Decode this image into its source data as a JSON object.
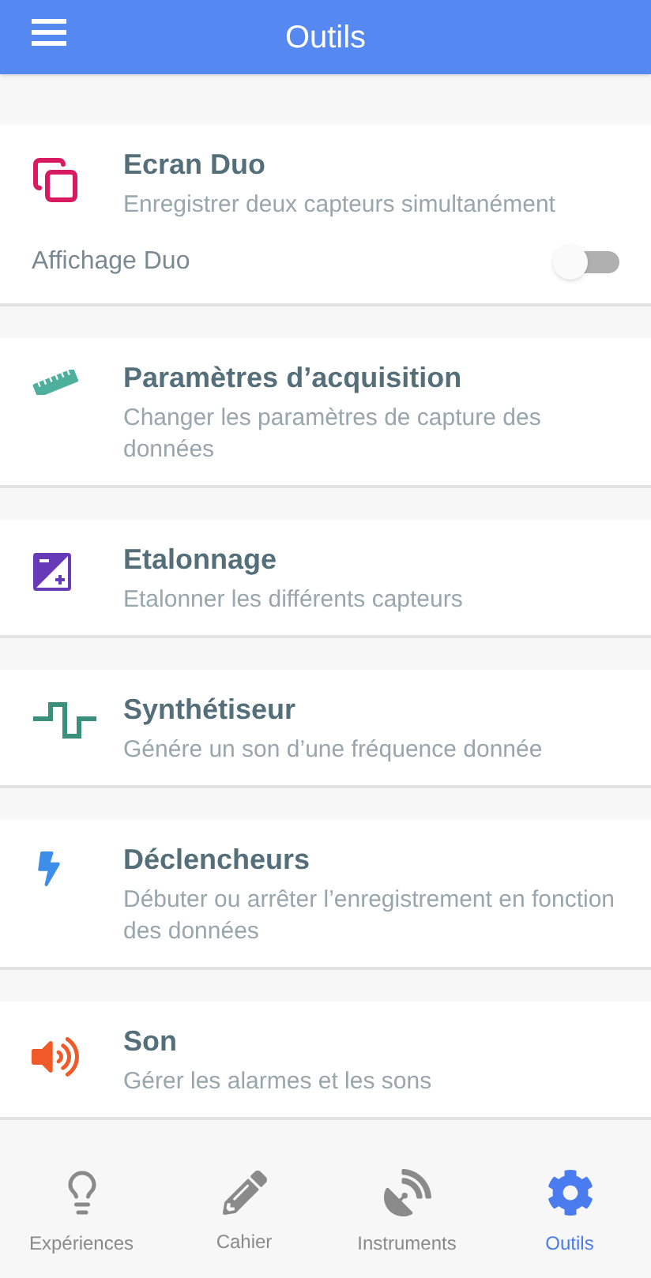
{
  "header": {
    "title": "Outils"
  },
  "tools": [
    {
      "title": "Ecran Duo",
      "subtitle": "Enregistrer deux capteurs simultanément",
      "toggle": {
        "label": "Affichage Duo",
        "on": false
      }
    },
    {
      "title": "Paramètres d’acquisition",
      "subtitle": "Changer les paramètres de capture des données"
    },
    {
      "title": "Etalonnage",
      "subtitle": "Etalonner les différents capteurs"
    },
    {
      "title": "Synthétiseur",
      "subtitle": "Génére un son d’une fréquence donnée"
    },
    {
      "title": "Déclencheurs",
      "subtitle": "Débuter ou arrêter l’enregistrement en fonction des données"
    },
    {
      "title": "Son",
      "subtitle": "Gérer les alarmes et les sons"
    }
  ],
  "tabs": [
    {
      "label": "Expériences",
      "selected": false
    },
    {
      "label": "Cahier",
      "selected": false
    },
    {
      "label": "Instruments",
      "selected": false
    },
    {
      "label": "Outils",
      "selected": true
    }
  ]
}
